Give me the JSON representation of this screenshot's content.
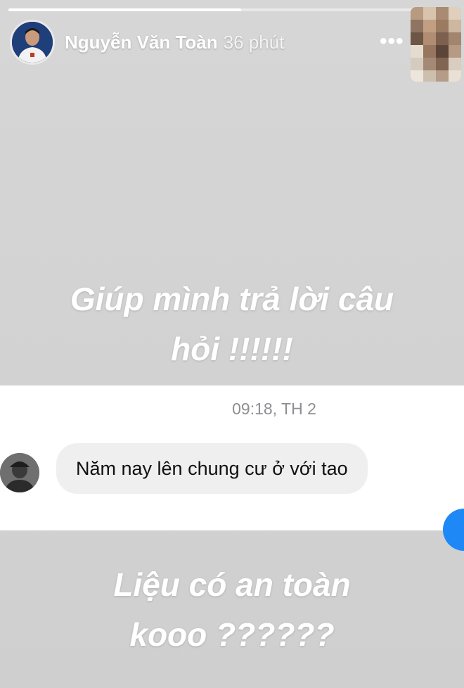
{
  "story": {
    "author": "Nguyễn Văn Toàn",
    "posted_ago": "36 phút",
    "more_label": "•••",
    "progress_fraction": 0.52,
    "text_top": [
      "Giúp mình trả lời câu",
      "hỏi !!!!!!"
    ],
    "text_bottom": [
      "Liệu có an toàn",
      "kooo ??????"
    ]
  },
  "chat": {
    "timestamp": "09:18, TH 2",
    "message": "Năm nay lên chung cư ở với tao"
  },
  "colors": {
    "story_bg": "#d2d2d2",
    "accent_blue": "#1e88f6"
  }
}
